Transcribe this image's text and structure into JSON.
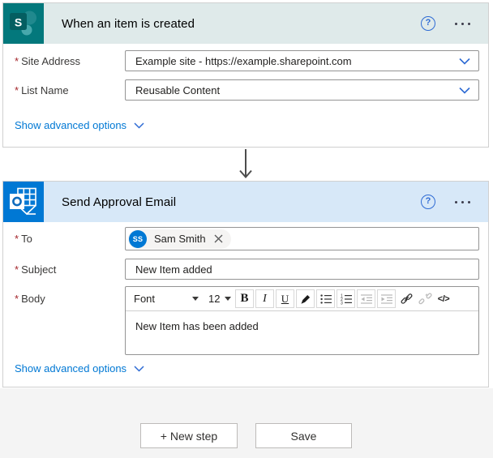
{
  "ui": {
    "required_marker": "*",
    "help_glyph": "?"
  },
  "trigger_card": {
    "title": "When an item is created",
    "connector": "sharepoint",
    "site_address": {
      "label": "Site Address",
      "value": "Example site - https://example.sharepoint.com"
    },
    "list_name": {
      "label": "List Name",
      "value": "Reusable Content"
    },
    "advanced_link": "Show advanced options"
  },
  "action_card": {
    "title": "Send Approval Email",
    "connector": "outlook",
    "to": {
      "label": "To",
      "recipient": {
        "initials": "SS",
        "name": "Sam Smith"
      }
    },
    "subject": {
      "label": "Subject",
      "value": "New Item added"
    },
    "body": {
      "label": "Body",
      "value": "New Item has been added",
      "toolbar": {
        "font_label": "Font",
        "font_size": "12",
        "bold": "B",
        "italic": "I",
        "underline": "U",
        "code": "</>"
      }
    },
    "advanced_link": "Show advanced options"
  },
  "footer": {
    "new_step_label": "+ New step",
    "save_label": "Save"
  },
  "colors": {
    "sharepoint_teal": "#03787c",
    "trigger_header_bg": "#dfeaea",
    "outlook_blue": "#0078d4",
    "action_header_bg": "#d7e8f8",
    "link_blue": "#0078d4",
    "required_red": "#a4262c",
    "avatar_blue": "#0078d4"
  }
}
